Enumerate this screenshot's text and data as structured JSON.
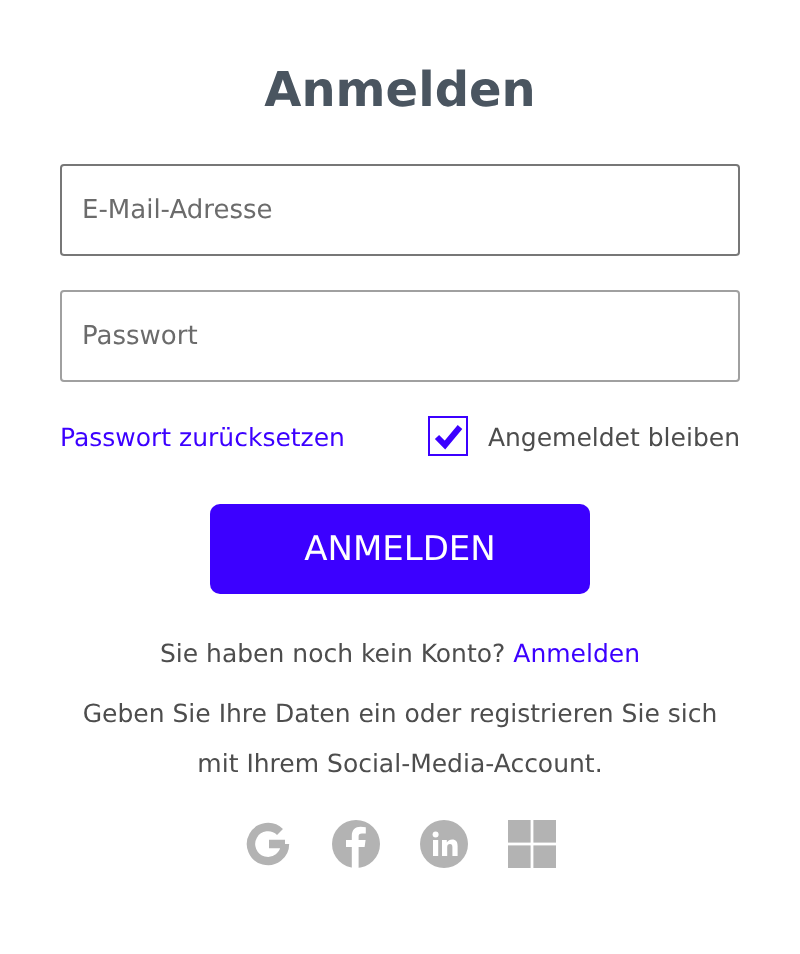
{
  "title": "Anmelden",
  "fields": [
    {
      "placeholder": "E-Mail-Adresse",
      "focused": true
    },
    {
      "placeholder": "Passwort",
      "focused": false
    }
  ],
  "reset_link": "Passwort zurücksetzen",
  "remember": {
    "label": "Angemeldet bleiben",
    "checked": true
  },
  "submit": "ANMELDEN",
  "signup": {
    "text": "Sie haben noch kein Konto?",
    "link": "Anmelden"
  },
  "social_text": "Geben Sie Ihre Daten ein oder registrieren Sie sich mit Ihrem Social-Media-Account.",
  "social": [
    {
      "kind": "g"
    },
    {
      "kind": "f"
    },
    {
      "kind": "in"
    },
    {
      "kind": "grid"
    }
  ]
}
